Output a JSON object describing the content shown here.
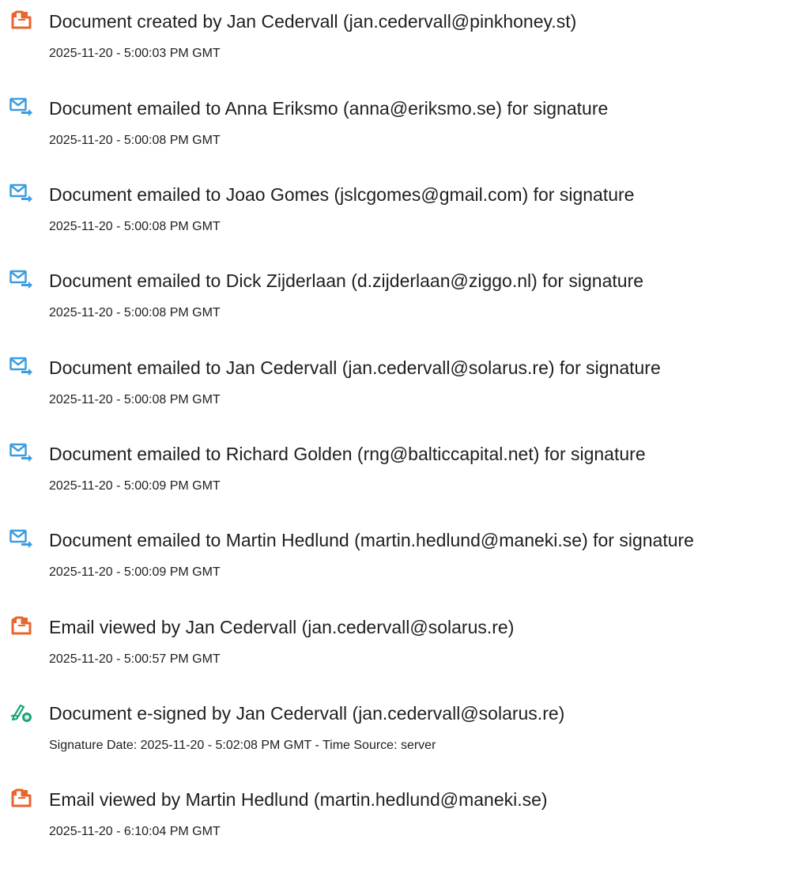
{
  "audit_trail": {
    "events": [
      {
        "icon": "document-created-icon",
        "title": "Document created by Jan Cedervall (jan.cedervall@pinkhoney.st)",
        "meta": "2025-11-20 - 5:00:03 PM GMT"
      },
      {
        "icon": "email-sent-icon",
        "title": "Document emailed to Anna Eriksmo (anna@eriksmo.se) for signature",
        "meta": "2025-11-20 - 5:00:08 PM GMT"
      },
      {
        "icon": "email-sent-icon",
        "title": "Document emailed to Joao Gomes (jslcgomes@gmail.com) for signature",
        "meta": "2025-11-20 - 5:00:08 PM GMT"
      },
      {
        "icon": "email-sent-icon",
        "title": "Document emailed to Dick Zijderlaan (d.zijderlaan@ziggo.nl) for signature",
        "meta": "2025-11-20 - 5:00:08 PM GMT"
      },
      {
        "icon": "email-sent-icon",
        "title": "Document emailed to Jan Cedervall (jan.cedervall@solarus.re) for signature",
        "meta": "2025-11-20 - 5:00:08 PM GMT"
      },
      {
        "icon": "email-sent-icon",
        "title": "Document emailed to Richard Golden (rng@balticcapital.net) for signature",
        "meta": "2025-11-20 - 5:00:09 PM GMT"
      },
      {
        "icon": "email-sent-icon",
        "title": "Document emailed to Martin Hedlund (martin.hedlund@maneki.se) for signature",
        "meta": "2025-11-20 - 5:00:09 PM GMT"
      },
      {
        "icon": "email-viewed-icon",
        "title": "Email viewed by Jan Cedervall (jan.cedervall@solarus.re)",
        "meta": "2025-11-20 - 5:00:57 PM GMT"
      },
      {
        "icon": "e-signature-icon",
        "title": "Document e-signed by Jan Cedervall (jan.cedervall@solarus.re)",
        "meta": "Signature Date: 2025-11-20 - 5:02:08 PM GMT - Time Source: server"
      },
      {
        "icon": "email-viewed-icon",
        "title": "Email viewed by Martin Hedlund (martin.hedlund@maneki.se)",
        "meta": "2025-11-20 - 6:10:04 PM GMT"
      }
    ]
  },
  "colors": {
    "document_icon": "#e8652e",
    "email_icon": "#3b9de0",
    "signature_icon": "#1fa37a",
    "text": "#1f1f1f"
  }
}
